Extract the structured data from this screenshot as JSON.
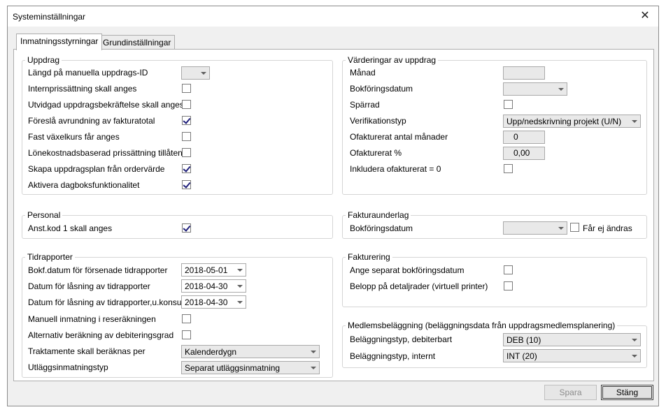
{
  "window": {
    "title": "Systeminställningar",
    "close_glyph": "✕"
  },
  "tabs": [
    {
      "label": "Inmatningsstyrningar",
      "active": true
    },
    {
      "label": "Grundinställningar",
      "active": false
    }
  ],
  "uppdrag": {
    "legend": "Uppdrag",
    "rows": [
      {
        "label": "Längd på manuella uppdrags-ID",
        "type": "combo",
        "value": ""
      },
      {
        "label": "Internprissättning skall anges",
        "type": "checkbox",
        "checked": false
      },
      {
        "label": "Utvidgad uppdragsbekräftelse skall anges",
        "type": "checkbox",
        "checked": false
      },
      {
        "label": "Föreslå avrundning av fakturatotal",
        "type": "checkbox",
        "checked": true
      },
      {
        "label": "Fast växelkurs får anges",
        "type": "checkbox",
        "checked": false
      },
      {
        "label": "Lönekostnadsbaserad prissättning tillåten",
        "type": "checkbox",
        "checked": false
      },
      {
        "label": "Skapa uppdragsplan från ordervärde",
        "type": "checkbox",
        "checked": true
      },
      {
        "label": "Aktivera dagboksfunktionalitet",
        "type": "checkbox",
        "checked": true
      }
    ]
  },
  "personal": {
    "legend": "Personal",
    "anst_label": "Anst.kod 1 skall anges",
    "anst_checked": true
  },
  "tidrapporter": {
    "legend": "Tidrapporter",
    "bokf_label": "Bokf.datum för försenade tidrapporter",
    "bokf_value": "2018-05-01",
    "lasning_label": "Datum för låsning av tidrapporter",
    "lasning_value": "2018-04-30",
    "lasning_u_label": "Datum för låsning av tidrapporter,u.konsult",
    "lasning_u_value": "2018-04-30",
    "manuell_label": "Manuell inmatning i reseräkningen",
    "manuell_checked": false,
    "alt_label": "Alternativ beräkning av debiteringsgrad",
    "alt_checked": false,
    "trakt_label": "Traktamente skall beräknas per",
    "trakt_value": "Kalenderdygn",
    "utlagg_label": "Utläggsinmatningstyp",
    "utlagg_value": "Separat utläggsinmatning"
  },
  "varderingar": {
    "legend": "Värderingar av uppdrag",
    "manad_label": "Månad",
    "manad_value": "",
    "bokf_label": "Bokföringsdatum",
    "bokf_value": "",
    "sparrad_label": "Spärrad",
    "sparrad_checked": false,
    "verif_label": "Verifikationstyp",
    "verif_value": "Upp/nedskrivning projekt (U/N)",
    "ofakt_man_label": "Ofakturerat antal månader",
    "ofakt_man_value": "0",
    "ofakt_pct_label": "Ofakturerat %",
    "ofakt_pct_value": "0,00",
    "inkl_label": "Inkludera ofakturerat = 0",
    "inkl_checked": false
  },
  "fakturaunderlag": {
    "legend": "Fakturaunderlag",
    "bokf_label": "Bokföringsdatum",
    "bokf_value": "",
    "far_ej_label": "Får ej ändras",
    "far_ej_checked": false
  },
  "fakturering": {
    "legend": "Fakturering",
    "ange_label": "Ange separat bokföringsdatum",
    "ange_checked": false,
    "belopp_label": "Belopp på detaljrader (virtuell printer)",
    "belopp_checked": false
  },
  "medlemsbelaggning": {
    "legend": "Medlemsbeläggning (beläggningsdata från uppdragsmedlemsplanering)",
    "deb_label": "Beläggningstyp, debiterbart",
    "deb_value": "DEB (10)",
    "int_label": "Beläggningstyp, internt",
    "int_value": "INT (20)"
  },
  "buttons": {
    "spara": "Spara",
    "stang": "Stäng"
  }
}
